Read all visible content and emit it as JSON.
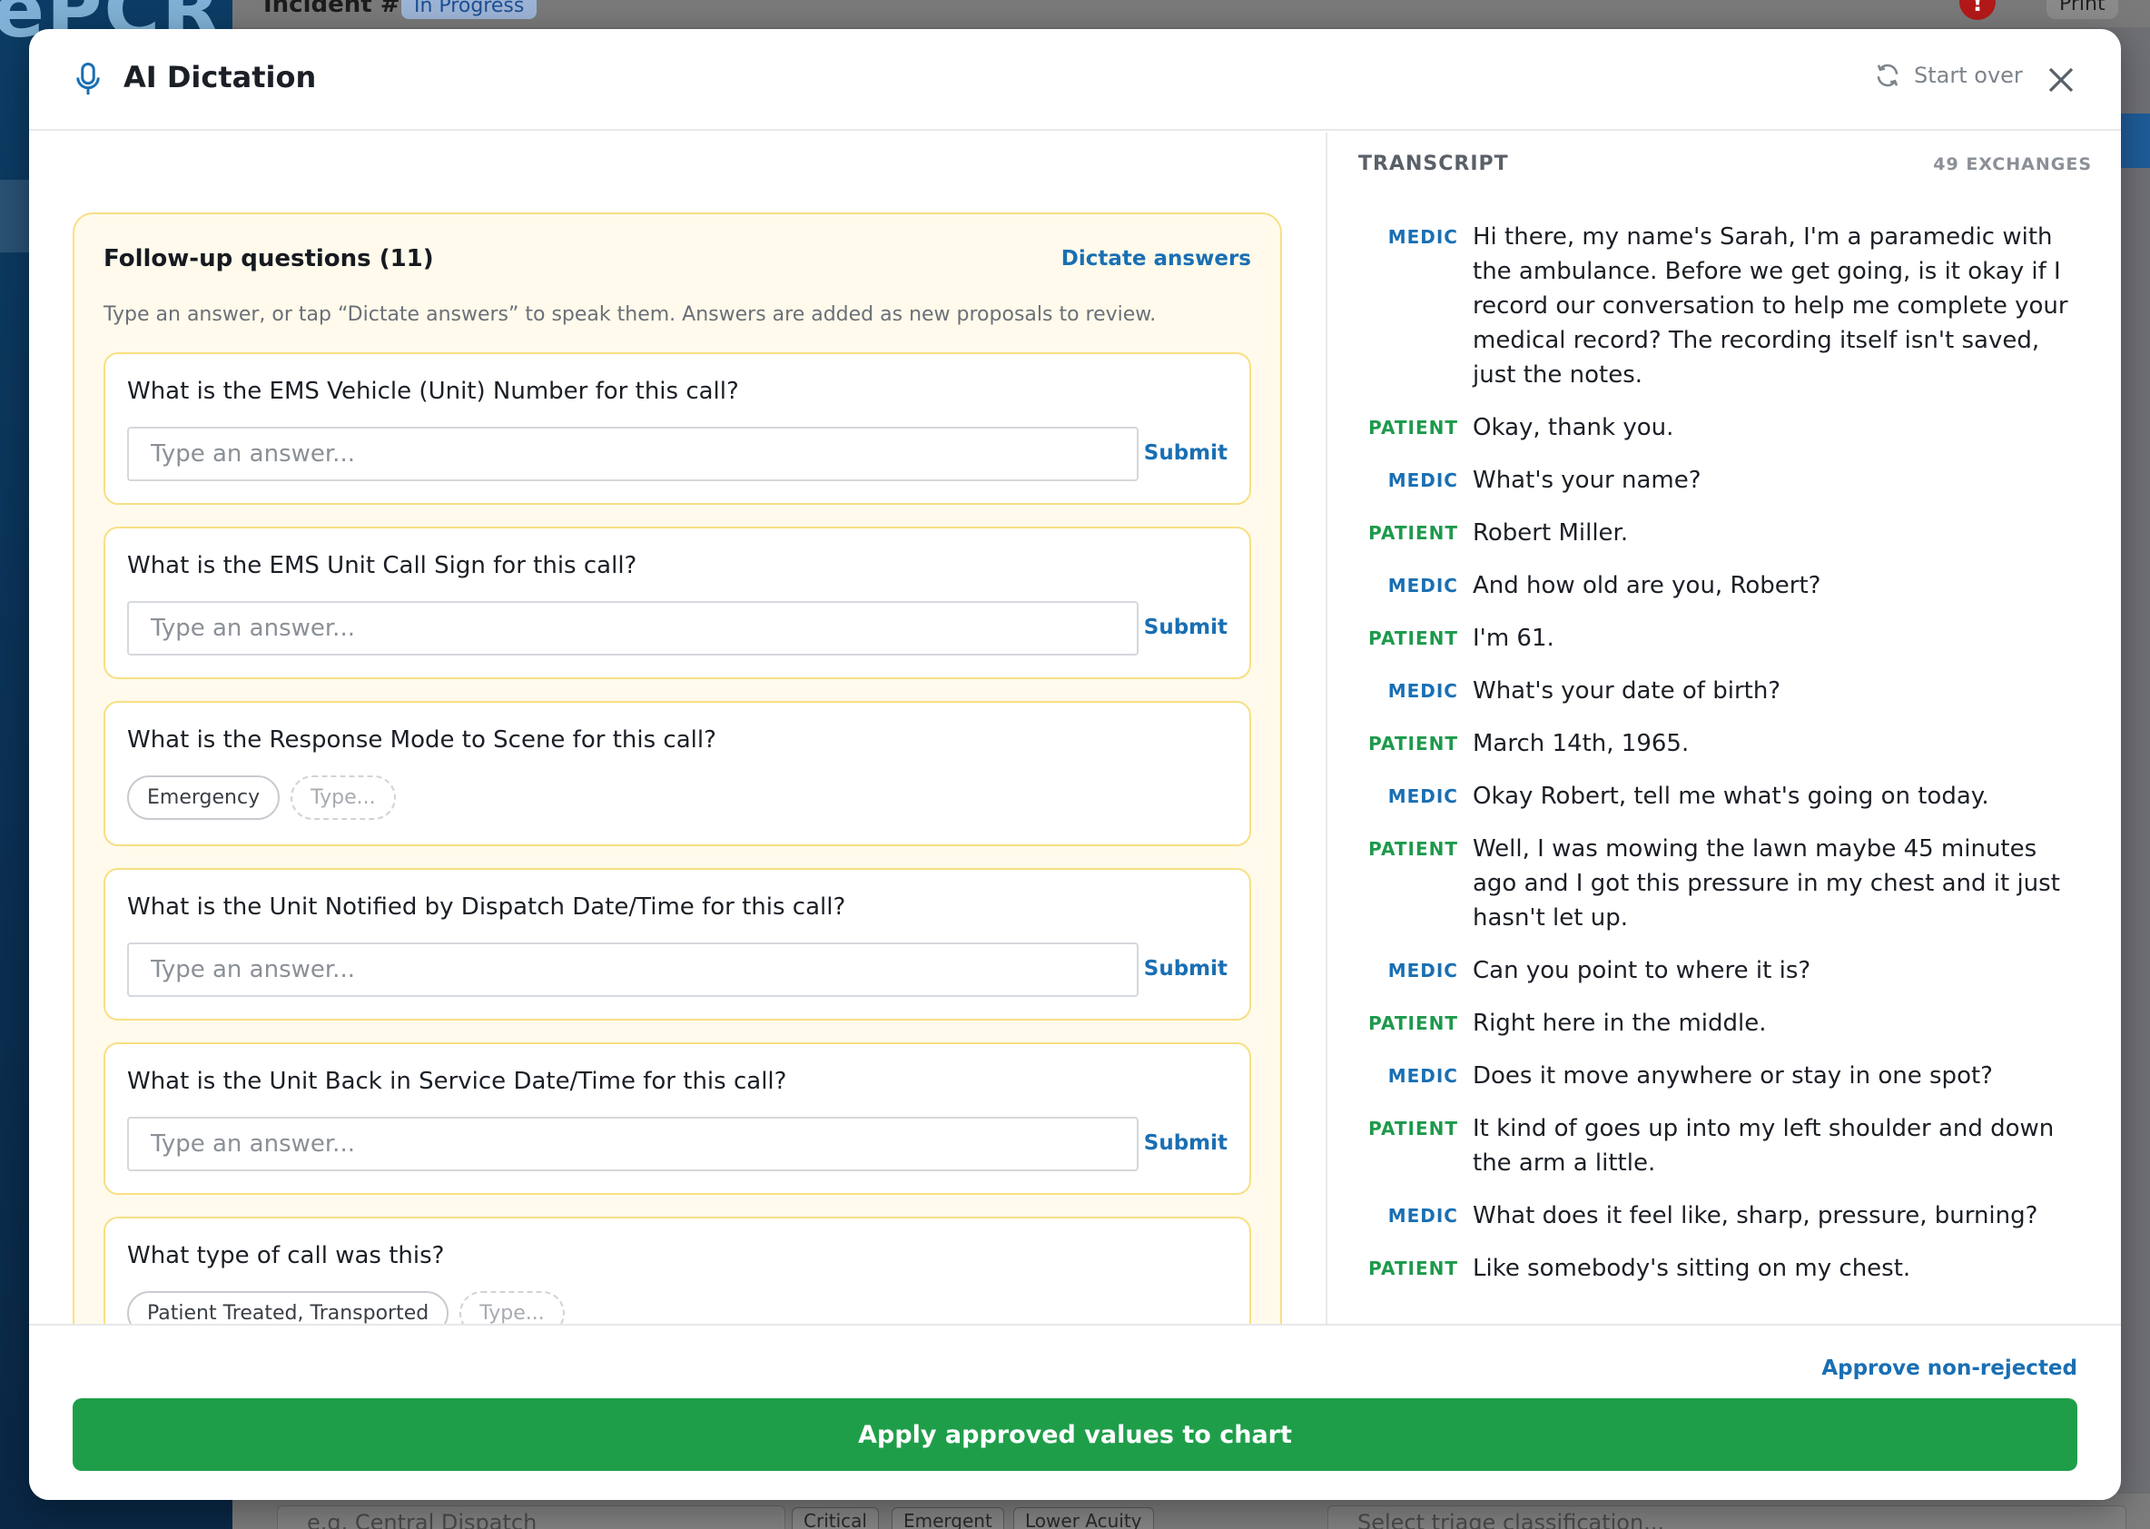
{
  "background": {
    "logo": "ePCR",
    "incident_label": "Incident #",
    "status_badge": "In Progress",
    "alert_badge": "!",
    "print_label": "Print",
    "dispatch_placeholder": "e.g. Central Dispatch",
    "acuity_chips": [
      "Critical",
      "Emergent",
      "Lower Acuity"
    ],
    "triage_placeholder": "Select triage classification..."
  },
  "modal": {
    "title": "AI Dictation",
    "start_over": "Start over",
    "icons": {
      "title": "microphone-icon",
      "start_over": "refresh-icon",
      "close": "close-icon"
    }
  },
  "followup": {
    "title": "Follow-up questions (11)",
    "dictate_label": "Dictate answers",
    "hint": "Type an answer, or tap “Dictate answers” to speak them. Answers are added as new proposals to review.",
    "placeholder": "Type an answer...",
    "submit_label": "Submit",
    "chip_placeholder": "Type...",
    "questions": [
      {
        "text": "What is the EMS Vehicle (Unit) Number for this call?"
      },
      {
        "text": "What is the EMS Unit Call Sign for this call?"
      },
      {
        "text": "What is the Response Mode to Scene for this call?",
        "chips": [
          "Emergency"
        ]
      },
      {
        "text": "What is the Unit Notified by Dispatch Date/Time for this call?"
      },
      {
        "text": "What is the Unit Back in Service Date/Time for this call?"
      },
      {
        "text": "What type of call was this?",
        "chips": [
          "Patient Treated, Transported"
        ]
      }
    ]
  },
  "transcript": {
    "title": "TRANSCRIPT",
    "count": "49 EXCHANGES",
    "entries": [
      {
        "speaker": "MEDIC",
        "text": "Hi there, my name's Sarah, I'm a paramedic with the ambulance. Before we get going, is it okay if I record our conversation to help me complete your medical record? The recording itself isn't saved, just the notes."
      },
      {
        "speaker": "PATIENT",
        "text": "Okay, thank you."
      },
      {
        "speaker": "MEDIC",
        "text": "What's your name?"
      },
      {
        "speaker": "PATIENT",
        "text": "Robert Miller."
      },
      {
        "speaker": "MEDIC",
        "text": "And how old are you, Robert?"
      },
      {
        "speaker": "PATIENT",
        "text": "I'm 61."
      },
      {
        "speaker": "MEDIC",
        "text": "What's your date of birth?"
      },
      {
        "speaker": "PATIENT",
        "text": "March 14th, 1965."
      },
      {
        "speaker": "MEDIC",
        "text": "Okay Robert, tell me what's going on today."
      },
      {
        "speaker": "PATIENT",
        "text": "Well, I was mowing the lawn maybe 45 minutes ago and I got this pressure in my chest and it just hasn't let up."
      },
      {
        "speaker": "MEDIC",
        "text": "Can you point to where it is?"
      },
      {
        "speaker": "PATIENT",
        "text": "Right here in the middle."
      },
      {
        "speaker": "MEDIC",
        "text": "Does it move anywhere or stay in one spot?"
      },
      {
        "speaker": "PATIENT",
        "text": "It kind of goes up into my left shoulder and down the arm a little."
      },
      {
        "speaker": "MEDIC",
        "text": "What does it feel like, sharp, pressure, burning?"
      },
      {
        "speaker": "PATIENT",
        "text": "Like somebody's sitting on my chest."
      }
    ]
  },
  "footer": {
    "approve_label": "Approve non-rejected",
    "apply_label": "Apply approved values to chart"
  },
  "colors": {
    "accent_blue": "#1a6fb3",
    "patient_green": "#1e9a4c",
    "apply_green": "#1f9e4a",
    "followup_border": "#f7df83",
    "followup_bg": "#fffaeb"
  }
}
